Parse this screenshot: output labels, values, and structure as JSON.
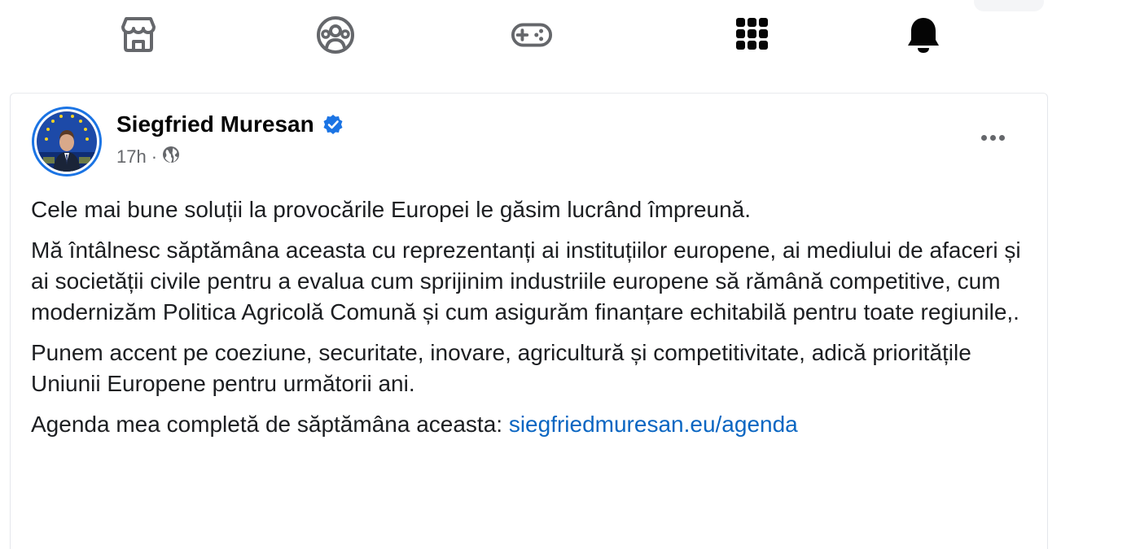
{
  "nav": {
    "icons": [
      "marketplace-icon",
      "groups-icon",
      "gaming-icon",
      "menu-grid-icon",
      "notifications-bell-icon"
    ]
  },
  "post": {
    "author": "Siegfried Muresan",
    "verified": true,
    "time": "17h",
    "separator": "·",
    "audience_icon": "globe-icon",
    "paragraphs": {
      "p1": "Cele mai bune soluții la provocările Europei le găsim lucrând împreună.",
      "p2": "Mă întâlnesc săptămâna aceasta cu reprezentanți ai instituțiilor europene, ai mediului de afaceri și ai societății civile pentru a evalua cum sprijinim industriile europene să rămână competitive, cum modernizăm Politica Agricolă Comună și cum asigurăm finanțare echitabilă pentru toate regiunile,.",
      "p3": "Punem accent pe coeziune, securitate, inovare, agricultură și competitivitate, adică prioritățile Uniunii Europene pentru următorii ani.",
      "p4_prefix": "Agenda mea completă de săptămâna aceasta: ",
      "p4_link": "siegfriedmuresan.eu/agenda"
    }
  },
  "colors": {
    "accent": "#1b74e4",
    "link": "#0a66c2",
    "text": "#1c1e21",
    "secondary": "#65676b"
  }
}
